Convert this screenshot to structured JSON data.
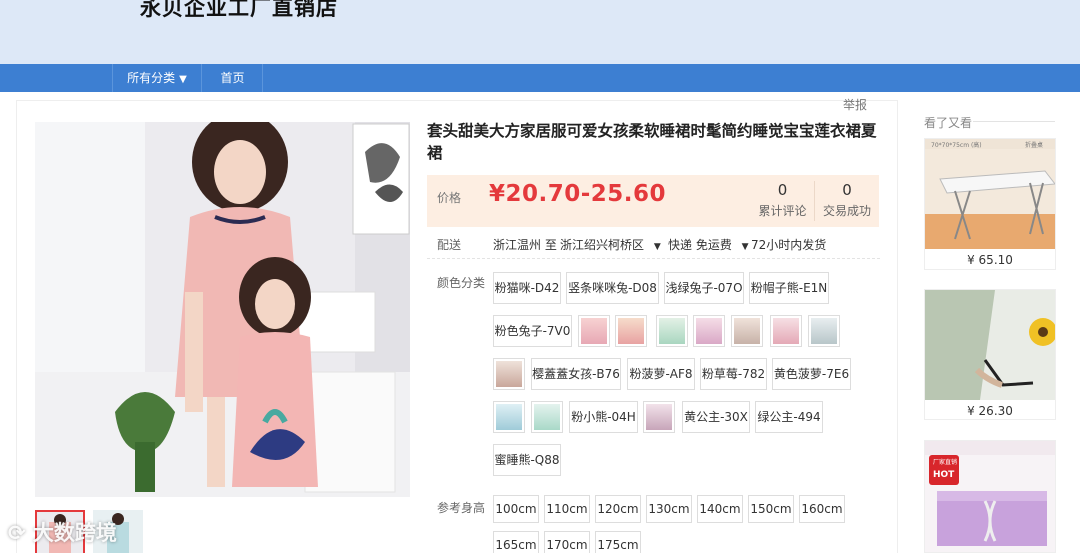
{
  "header": {
    "shop_name": "永贝企业工厂直销店"
  },
  "nav": {
    "all_categories": "所有分类",
    "caret": "▼",
    "home": "首页"
  },
  "report": "举报",
  "product": {
    "title": "套头甜美大方家居服可爱女孩柔软睡裙时髦简约睡觉宝宝莲衣裙夏裙",
    "price_label": "价格",
    "price": "¥20.70-25.60",
    "review_count": "0",
    "review_label": "累计评论",
    "deal_count": "0",
    "deal_label": "交易成功"
  },
  "shipping": {
    "label": "配送",
    "origin": "浙江温州 至",
    "destination": "浙江绍兴柯桥区",
    "method": "快递 免运费",
    "dropdown": "▼",
    "dispatch": "72小时内发货"
  },
  "colors": {
    "label": "颜色分类",
    "options": [
      "粉猫咪-D42",
      "竖条咪咪兔-D08",
      "浅绿兔子-07O",
      "粉帽子熊-E1N",
      "粉色兔子-7V0",
      "樱蓋蓋女孩-B76",
      "粉菠萝-AF8",
      "粉草莓-782",
      "黄色菠萝-7E6",
      "粉小熊-04H",
      "黄公主-30X",
      "绿公主-494",
      "蜜睡熊-Q88"
    ]
  },
  "sizes": {
    "label": "参考身高",
    "options": [
      "100cm",
      "110cm",
      "120cm",
      "130cm",
      "140cm",
      "150cm",
      "160cm",
      "165cm",
      "170cm",
      "175cm"
    ]
  },
  "sidebar": {
    "title": "看了又看",
    "items": [
      {
        "price": "¥ 65.10",
        "image_caption": "70*70*75cm (高)",
        "image_caption2": "折叠桌"
      },
      {
        "price": "¥ 26.30"
      },
      {
        "badge": "厂家直销",
        "hot": "HOT"
      }
    ]
  },
  "watermark": "跨境",
  "watermark_prefix": "大数",
  "colors_palette": {
    "accent": "#e4393c",
    "nav": "#3d7fd2",
    "header": "#dde8f7",
    "price_bg": "#fdeee2"
  }
}
